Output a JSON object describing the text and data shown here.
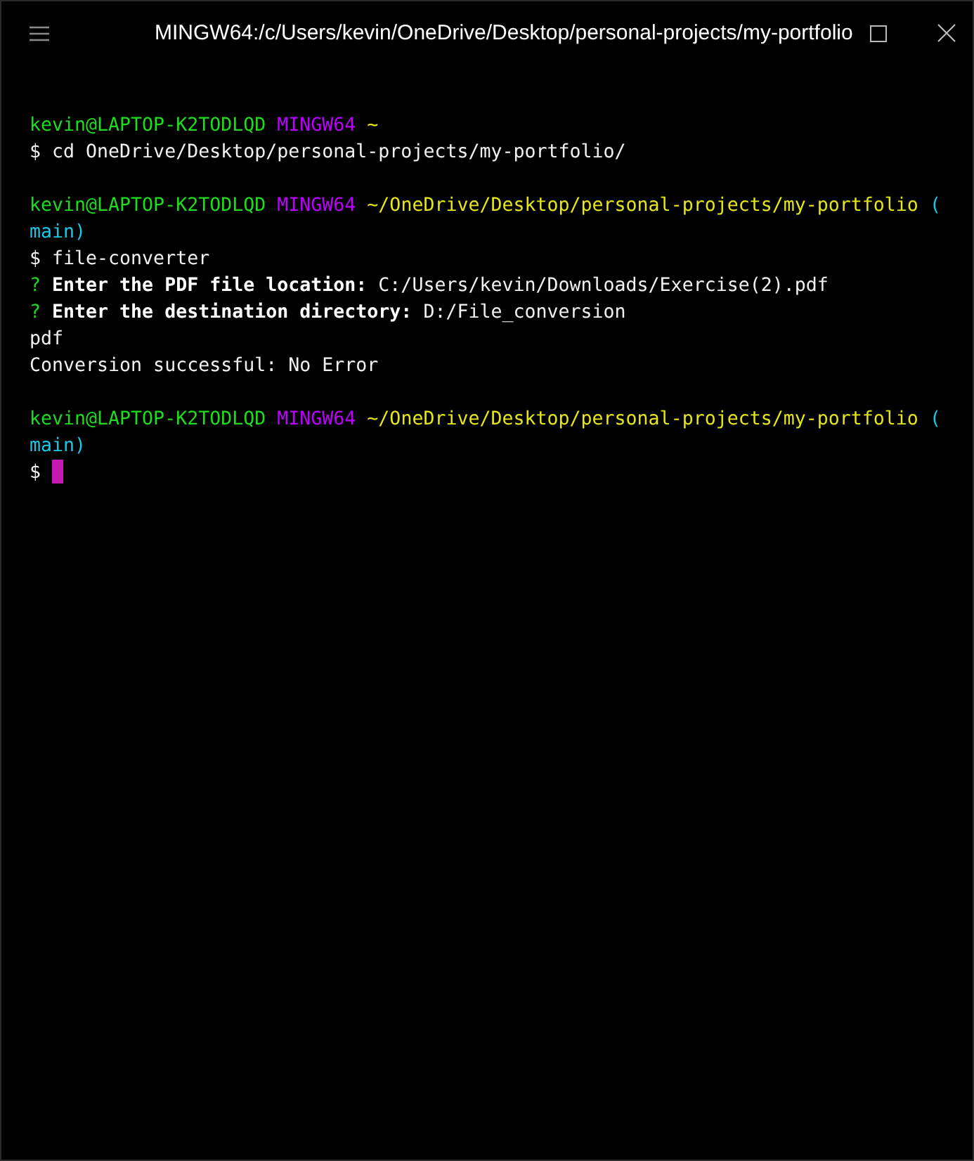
{
  "window": {
    "title": "MINGW64:/c/Users/kevin/OneDrive/Desktop/personal-projects/my-portfolio"
  },
  "terminal": {
    "lines": [
      {
        "gap_before": false,
        "segments": [
          {
            "kind": "user",
            "text": "kevin@LAPTOP-K2TODLQD"
          },
          {
            "kind": "host",
            "text": "MINGW64"
          },
          {
            "kind": "path",
            "text": "~"
          }
        ]
      },
      {
        "gap_before": false,
        "segments": [
          {
            "kind": "plain",
            "text": "$ cd OneDrive/Desktop/personal-projects/my-portfolio/"
          }
        ]
      },
      {
        "gap_before": true,
        "segments": [
          {
            "kind": "user",
            "text": "kevin@LAPTOP-K2TODLQD"
          },
          {
            "kind": "host",
            "text": "MINGW64"
          },
          {
            "kind": "path",
            "text": "~/OneDrive/Desktop/personal-projects/my-portfolio"
          },
          {
            "kind": "branch",
            "text": "("
          }
        ]
      },
      {
        "gap_before": false,
        "segments": [
          {
            "kind": "branch",
            "text": "main)"
          }
        ]
      },
      {
        "gap_before": false,
        "segments": [
          {
            "kind": "plain",
            "text": "$ file-converter"
          }
        ]
      },
      {
        "gap_before": false,
        "segments": [
          {
            "kind": "question",
            "text": "?"
          },
          {
            "kind": "label",
            "text": "Enter the PDF file location:"
          },
          {
            "kind": "plain",
            "text": "C:/Users/kevin/Downloads/Exercise(2).pdf"
          }
        ]
      },
      {
        "gap_before": false,
        "segments": [
          {
            "kind": "question",
            "text": "?"
          },
          {
            "kind": "label",
            "text": "Enter the destination directory:"
          },
          {
            "kind": "plain",
            "text": "D:/File_conversion"
          }
        ]
      },
      {
        "gap_before": false,
        "segments": [
          {
            "kind": "plain",
            "text": "pdf"
          }
        ]
      },
      {
        "gap_before": false,
        "segments": [
          {
            "kind": "plain",
            "text": "Conversion successful: No Error"
          }
        ]
      },
      {
        "gap_before": true,
        "segments": [
          {
            "kind": "user",
            "text": "kevin@LAPTOP-K2TODLQD"
          },
          {
            "kind": "host",
            "text": "MINGW64"
          },
          {
            "kind": "path",
            "text": "~/OneDrive/Desktop/personal-projects/my-portfolio"
          },
          {
            "kind": "branch",
            "text": "("
          }
        ]
      },
      {
        "gap_before": false,
        "segments": [
          {
            "kind": "branch",
            "text": "main)"
          }
        ]
      },
      {
        "gap_before": false,
        "cursor": true,
        "segments": [
          {
            "kind": "plain",
            "text": "$"
          }
        ]
      }
    ]
  }
}
